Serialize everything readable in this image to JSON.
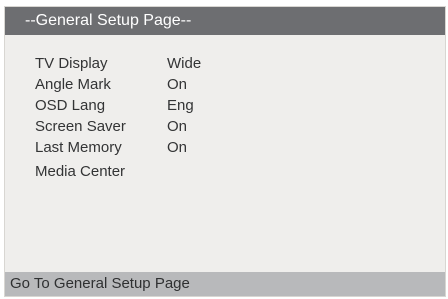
{
  "header": {
    "title": "--General Setup Page--"
  },
  "menu": {
    "items": [
      {
        "label": "TV Display",
        "value": "Wide"
      },
      {
        "label": "Angle Mark",
        "value": "On"
      },
      {
        "label": "OSD Lang",
        "value": "Eng"
      },
      {
        "label": "Screen Saver",
        "value": "On"
      },
      {
        "label": "Last Memory",
        "value": "On"
      },
      {
        "label": "Media Center",
        "value": ""
      }
    ]
  },
  "footer": {
    "status": "Go To General Setup Page"
  },
  "colors": {
    "header_bg": "#6d6e71",
    "panel_bg": "#efeeec",
    "footer_bg": "#b8b9bb",
    "text": "#333435"
  }
}
